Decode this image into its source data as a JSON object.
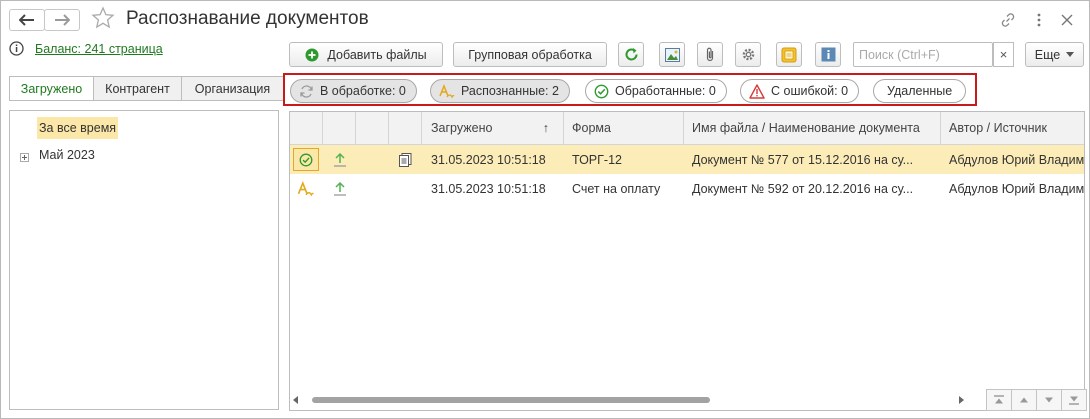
{
  "window": {
    "title": "Распознавание документов"
  },
  "left": {
    "balance": "Баланс: 241 страница",
    "tabs": [
      {
        "label": "Загружено",
        "active": true
      },
      {
        "label": "Контрагент",
        "active": false
      },
      {
        "label": "Организация",
        "active": false
      }
    ],
    "list": {
      "all_time": "За все время",
      "month": "Май 2023"
    }
  },
  "toolbar": {
    "add_files": "Добавить файлы",
    "group_processing": "Групповая обработка",
    "search_placeholder": "Поиск (Ctrl+F)",
    "clear": "×",
    "more": "Еще",
    "icons": [
      "refresh-icon",
      "image-icon",
      "paperclip-icon",
      "gear-icon",
      "document-scan-icon",
      "info-icon"
    ]
  },
  "filters": [
    {
      "label": "В обработке: 0",
      "icon": "sync-icon",
      "active": true
    },
    {
      "label": "Распознанные: 2",
      "icon": "recognize-icon",
      "active": true
    },
    {
      "label": "Обработанные: 0",
      "icon": "check-circle-icon",
      "active": false
    },
    {
      "label": "С ошибкой: 0",
      "icon": "warning-icon",
      "active": false
    },
    {
      "label": "Удаленные",
      "icon": "",
      "active": false
    }
  ],
  "table": {
    "columns": [
      "Загружено",
      "Форма",
      "Имя файла / Наименование документа",
      "Автор / Источник"
    ],
    "sort_indicator": "↑",
    "rows": [
      {
        "status": "processed",
        "uploaded": "31.05.2023 10:51:18",
        "form": "ТОРГ-12",
        "name": "Документ № 577 от 15.12.2016 на су...",
        "author": "Абдулов Юрий Владим",
        "selected": true
      },
      {
        "status": "recognized",
        "uploaded": "31.05.2023 10:51:18",
        "form": "Счет на оплату",
        "name": "Документ № 592 от 20.12.2016 на су...",
        "author": "Абдулов Юрий Владим",
        "selected": false
      }
    ]
  },
  "colors": {
    "accent_green": "#1f7a1f",
    "highlight_red": "#c81a1a",
    "selection": "#fcedb8"
  }
}
